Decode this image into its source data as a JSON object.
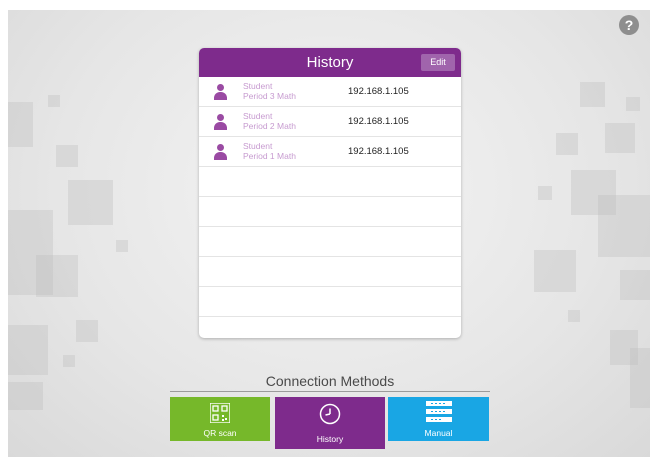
{
  "help": {
    "glyph": "?"
  },
  "history": {
    "title": "History",
    "edit_label": "Edit",
    "rows": [
      {
        "line1": "Student",
        "line2": "Period 3 Math",
        "ip": "192.168.1.105"
      },
      {
        "line1": "Student",
        "line2": "Period 2 Math",
        "ip": "192.168.1.105"
      },
      {
        "line1": "Student",
        "line2": "Period 1 Math",
        "ip": "192.168.1.105"
      }
    ]
  },
  "connection_methods": {
    "title": "Connection Methods",
    "tabs": {
      "qr": {
        "label": "QR scan",
        "icon": "qr-code-icon"
      },
      "history": {
        "label": "History",
        "icon": "clock-icon"
      },
      "manual": {
        "label": "Manual",
        "icon": "keypad-icon"
      }
    }
  },
  "colors": {
    "purple": "#7e2b8c",
    "green": "#76b82a",
    "blue": "#19a6e4",
    "light_purple_text": "#c79bd0"
  }
}
